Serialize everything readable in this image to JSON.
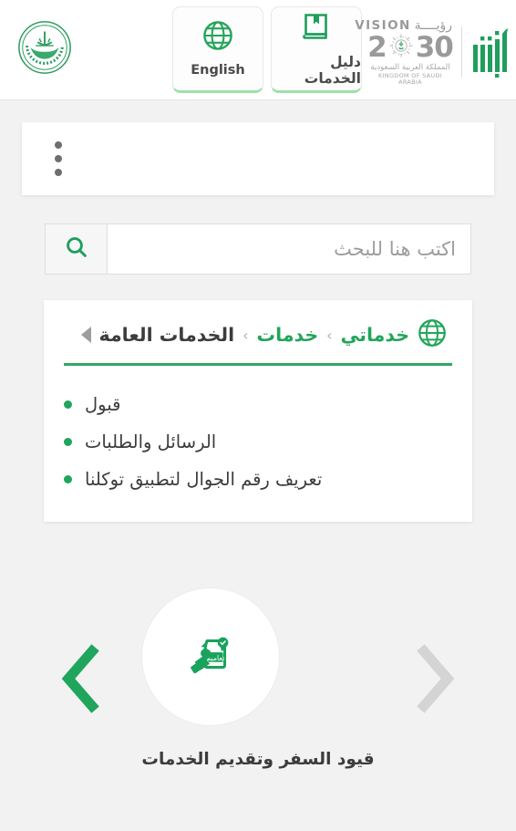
{
  "header": {
    "emblem_name": "moi-emblem",
    "buttons": [
      {
        "label": "English",
        "icon": "globe-icon",
        "name": "language-toggle-button"
      },
      {
        "label": "دليل الخدمات",
        "icon": "book-icon",
        "name": "services-guide-button"
      }
    ],
    "vision": {
      "vision_word": "VISION",
      "roya_word": "رؤيــــة",
      "num_left": "2",
      "num_right": "30",
      "kingdom_ar": "المملكة العربية السعودية",
      "kingdom_en": "KINGDOM OF SAUDI ARABIA"
    },
    "absher_logo_name": "absher-logo"
  },
  "menu": {
    "kebab_label": "القائمة"
  },
  "search": {
    "placeholder": "اكتب هنا للبحث",
    "value": "",
    "button_icon": "search-icon"
  },
  "breadcrumb": {
    "globe_icon": "globe-icon",
    "expand_icon": "triangle-right-icon",
    "separator": "›",
    "items": [
      {
        "label": "خدماتي",
        "current": false
      },
      {
        "label": "خدمات",
        "current": false
      },
      {
        "label": "الخدمات العامة",
        "current": true
      }
    ],
    "list": [
      {
        "label": "قبول"
      },
      {
        "label": "الرسائل والطلبات"
      },
      {
        "label": "تعريف رقم الجوال لتطبيق توكلنا"
      }
    ]
  },
  "carousel": {
    "prev_icon": "chevron-left-icon",
    "next_icon": "chevron-right-icon",
    "tile": {
      "icon": "circular-document-icon",
      "icon_text": "تعاميم",
      "caption": "قيود السفر وتقديم الخدمات"
    }
  },
  "colors": {
    "brand_green": "#23a55a",
    "accent_green": "#2ea865",
    "page_bg": "#f2f2f2",
    "card_bg": "#ffffff",
    "text": "#3c3c3c",
    "muted": "#9d9d9d",
    "chevron_inactive": "#d4d4d4"
  }
}
